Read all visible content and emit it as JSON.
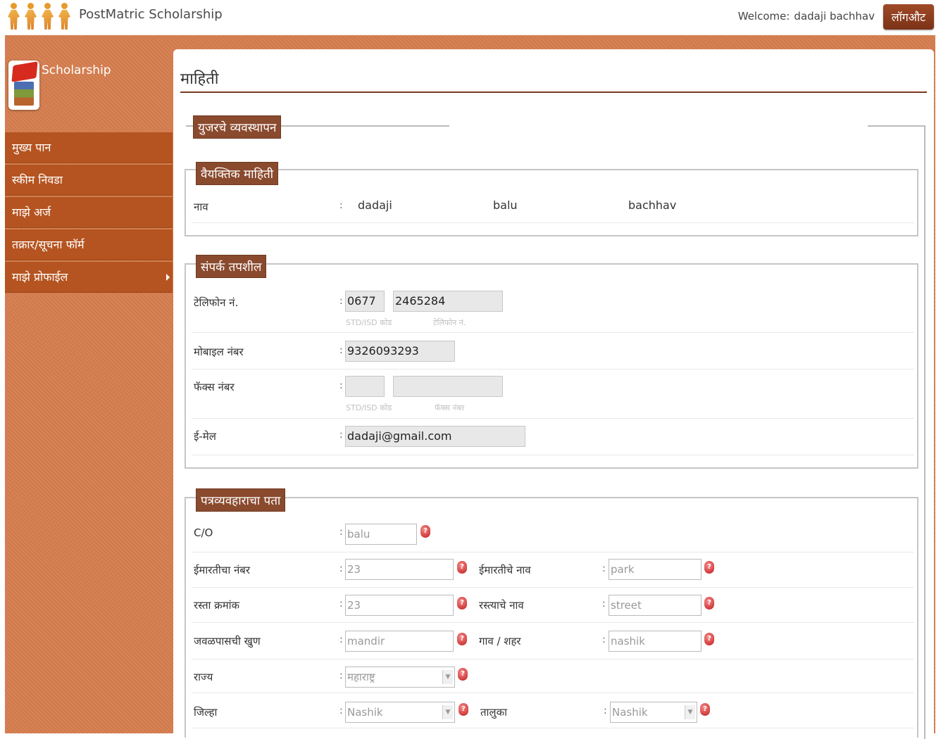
{
  "header": {
    "app_title": "PostMatric Scholarship",
    "welcome_label": "Welcome:",
    "user_name": "dadaji bachhav",
    "logout_label": "लॉगऔट"
  },
  "sidebar": {
    "brand_label": "Scholarship",
    "items": [
      {
        "label": "मुख्य पान"
      },
      {
        "label": "स्कीम निवडा"
      },
      {
        "label": "माझे अर्ज"
      },
      {
        "label": "तक्रार/सूचना फॉर्म"
      },
      {
        "label": "माझे प्रोफाईल"
      }
    ]
  },
  "page": {
    "title": "माहिती",
    "section_user": "युजरचे व्यवस्थापन"
  },
  "personal": {
    "legend": "वैयक्तिक माहिती",
    "name_label": "नाव",
    "first_name": "dadaji",
    "middle_name": "balu",
    "last_name": "bachhav"
  },
  "contact": {
    "legend": "संपर्क तपशील",
    "phone_label": "टेलिफोन नं.",
    "phone_std": "0677",
    "phone_number": "2465284",
    "std_hint": "STD/ISD कोड",
    "phone_hint": "टेलिफोन नं.",
    "mobile_label": "मोबाइल नंबर",
    "mobile": "9326093293",
    "fax_label": "फॅक्स नंबर",
    "fax_std": "",
    "fax_number": "",
    "fax_std_hint": "STD/ISD कोड",
    "fax_hint": "फॅक्स नंबर",
    "email_label": "ई-मेल",
    "email": "dadaji@gmail.com"
  },
  "address": {
    "legend": "पत्रव्यवहाराचा पता",
    "co_label": "C/O",
    "co": "balu",
    "building_no_label": "ईमारतीचा नंबर",
    "building_no": "23",
    "building_name_label": "ईमारतीचे नाव",
    "building_name": "park",
    "road_no_label": "रस्ता क्रमांक",
    "road_no": "23",
    "road_name_label": "रस्त्याचे नाव",
    "road_name": "street",
    "landmark_label": "जवळपासची खुण",
    "landmark": "mandir",
    "city_label": "गाव / शहर",
    "city": "nashik",
    "state_label": "राज्य",
    "state": "महाराष्ट्र",
    "district_label": "जिल्हा",
    "district": "Nashik",
    "taluka_label": "तालुका",
    "taluka": "Nashik"
  }
}
